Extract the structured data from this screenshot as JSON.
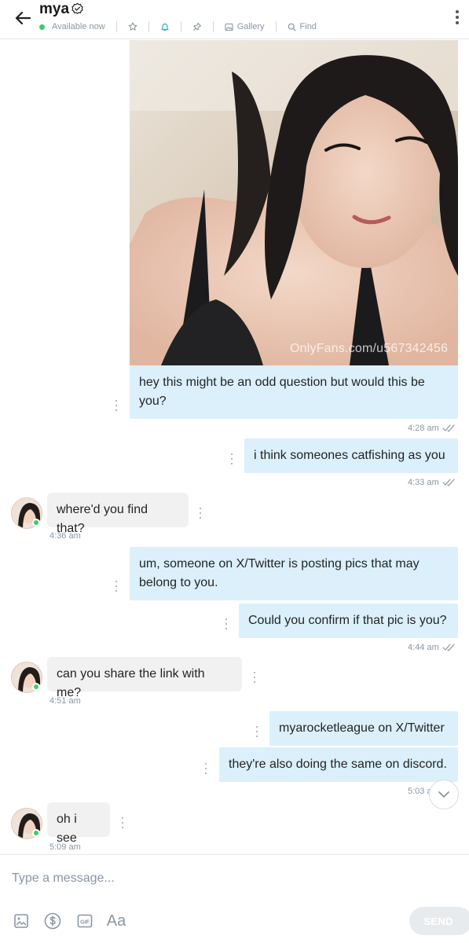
{
  "header": {
    "name": "mya",
    "status": "Available now",
    "gallery_label": "Gallery",
    "find_label": "Find",
    "icons": [
      "back-arrow-icon",
      "verified-icon",
      "star-icon",
      "bell-icon",
      "pin-icon",
      "gallery-icon",
      "search-icon",
      "more-vertical-icon"
    ],
    "status_color": "#3dcb6a"
  },
  "messages": [
    {
      "side": "out",
      "type": "photo",
      "watermark": "OnlyFans.com/u567342456"
    },
    {
      "side": "out",
      "text": "hey this might be an odd question but would this be you?",
      "time": "4:28 am"
    },
    {
      "side": "out",
      "text": "i think someones catfishing as you",
      "time": "4:33 am"
    },
    {
      "side": "in",
      "text": "where'd you find that?",
      "time": "4:36 am"
    },
    {
      "side": "out",
      "text": "um, someone on X/Twitter is posting pics that may belong to you."
    },
    {
      "side": "out",
      "text": "Could you confirm if that pic is you?",
      "time": "4:44 am"
    },
    {
      "side": "in",
      "text": "can you share the link with me?",
      "time": "4:51 am"
    },
    {
      "side": "out",
      "text": "myarocketleague on X/Twitter"
    },
    {
      "side": "out",
      "text": "they're also doing the same on discord.",
      "time": "5:03 am"
    },
    {
      "side": "in",
      "text": "oh i see",
      "time": "5:09 am"
    }
  ],
  "composer": {
    "placeholder": "Type a message...",
    "format_label": "Aa",
    "send_label": "SEND",
    "icons": [
      "image-icon",
      "dollar-icon",
      "gif-icon",
      "text-format-icon"
    ]
  },
  "colors": {
    "outgoing_bubble": "#dbf0fb",
    "incoming_bubble": "#f1f1f1",
    "meta_text": "#8a96a3"
  }
}
